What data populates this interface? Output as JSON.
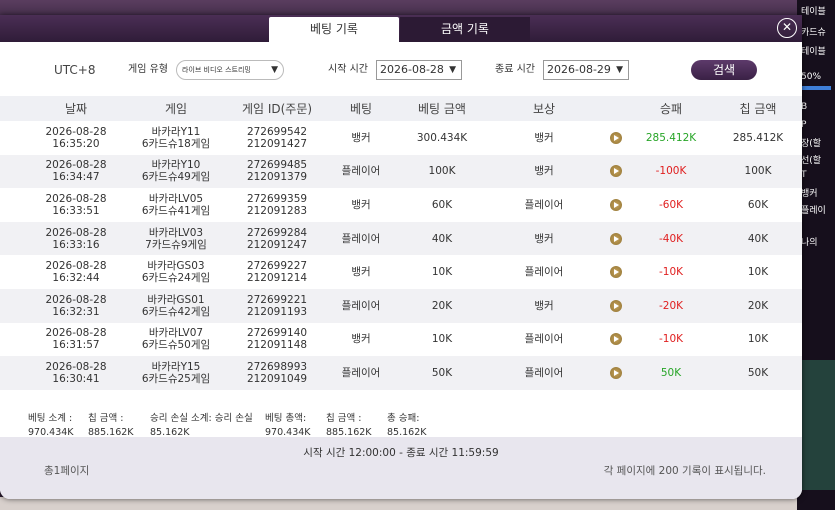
{
  "background": {
    "side_texts": [
      "테이블",
      "카드슈",
      "테이블",
      "50%",
      "B",
      "P",
      "장(할",
      "선(할",
      "T",
      "뱅커",
      "플레이",
      "나의"
    ]
  },
  "tabs": {
    "betting": "베팅 기록",
    "amount": "금액 기록"
  },
  "close_icon": "✕",
  "filters": {
    "timezone": "UTC+8",
    "game_type_label": "게임 유형",
    "game_type_value": "라이브 비디오 스트리밍",
    "start_label": "시작 시간",
    "start_date": "2026-08-28",
    "end_label": "종료 시간",
    "end_date": "2026-08-29",
    "search_label": "검색",
    "dropdown_arrow": "▼"
  },
  "table": {
    "headers": [
      "날짜",
      "게임",
      "게임 ID(주문)",
      "베팅",
      "베팅 금액",
      "보상",
      "승패",
      "칩 금액"
    ],
    "rows": [
      {
        "date": "2026-08-28",
        "time": "16:35:20",
        "game1": "바카라Y11",
        "game2": "6카드슈18게임",
        "id1": "272699542",
        "id2": "212091427",
        "bet": "뱅커",
        "amount": "300.434K",
        "reward": "뱅커",
        "result": "285.412K",
        "result_color": "green",
        "chip": "285.412K"
      },
      {
        "date": "2026-08-28",
        "time": "16:34:47",
        "game1": "바카라Y10",
        "game2": "6카드슈49게임",
        "id1": "272699485",
        "id2": "212091379",
        "bet": "플레이어",
        "amount": "100K",
        "reward": "뱅커",
        "result": "-100K",
        "result_color": "red",
        "chip": "100K"
      },
      {
        "date": "2026-08-28",
        "time": "16:33:51",
        "game1": "바카라LV05",
        "game2": "6카드슈41게임",
        "id1": "272699359",
        "id2": "212091283",
        "bet": "뱅커",
        "amount": "60K",
        "reward": "플레이어",
        "result": "-60K",
        "result_color": "red",
        "chip": "60K"
      },
      {
        "date": "2026-08-28",
        "time": "16:33:16",
        "game1": "바카라LV03",
        "game2": "7카드슈9게임",
        "id1": "272699284",
        "id2": "212091247",
        "bet": "플레이어",
        "amount": "40K",
        "reward": "뱅커",
        "result": "-40K",
        "result_color": "red",
        "chip": "40K"
      },
      {
        "date": "2026-08-28",
        "time": "16:32:44",
        "game1": "바카라GS03",
        "game2": "6카드슈24게임",
        "id1": "272699227",
        "id2": "212091214",
        "bet": "뱅커",
        "amount": "10K",
        "reward": "플레이어",
        "result": "-10K",
        "result_color": "red",
        "chip": "10K"
      },
      {
        "date": "2026-08-28",
        "time": "16:32:31",
        "game1": "바카라GS01",
        "game2": "6카드슈42게임",
        "id1": "272699221",
        "id2": "212091193",
        "bet": "플레이어",
        "amount": "20K",
        "reward": "뱅커",
        "result": "-20K",
        "result_color": "red",
        "chip": "20K"
      },
      {
        "date": "2026-08-28",
        "time": "16:31:57",
        "game1": "바카라LV07",
        "game2": "6카드슈50게임",
        "id1": "272699140",
        "id2": "212091148",
        "bet": "뱅커",
        "amount": "10K",
        "reward": "플레이어",
        "result": "-10K",
        "result_color": "red",
        "chip": "10K"
      },
      {
        "date": "2026-08-28",
        "time": "16:30:41",
        "game1": "바카라Y15",
        "game2": "6카드슈25게임",
        "id1": "272698993",
        "id2": "212091049",
        "bet": "플레이어",
        "amount": "50K",
        "reward": "플레이어",
        "result": "50K",
        "result_color": "green",
        "chip": "50K"
      }
    ]
  },
  "summary": [
    {
      "label": "베팅 소계 :",
      "value": "970.434K"
    },
    {
      "label": "칩 금액 :",
      "value": "885.162K"
    },
    {
      "label": "승리 손실 소계: 승리 손실",
      "value": "85.162K"
    },
    {
      "label": "베팅 총액:",
      "value": "970.434K"
    },
    {
      "label": "칩 금액 :",
      "value": "885.162K"
    },
    {
      "label": "총 승패:",
      "value": "85.162K"
    }
  ],
  "footer": {
    "time_range": "시작 시간 12:00:00 - 종료 시간 11:59:59",
    "total_pages": "총1페이지",
    "per_page": "각 페이지에 200 기록이 표시됩니다."
  }
}
